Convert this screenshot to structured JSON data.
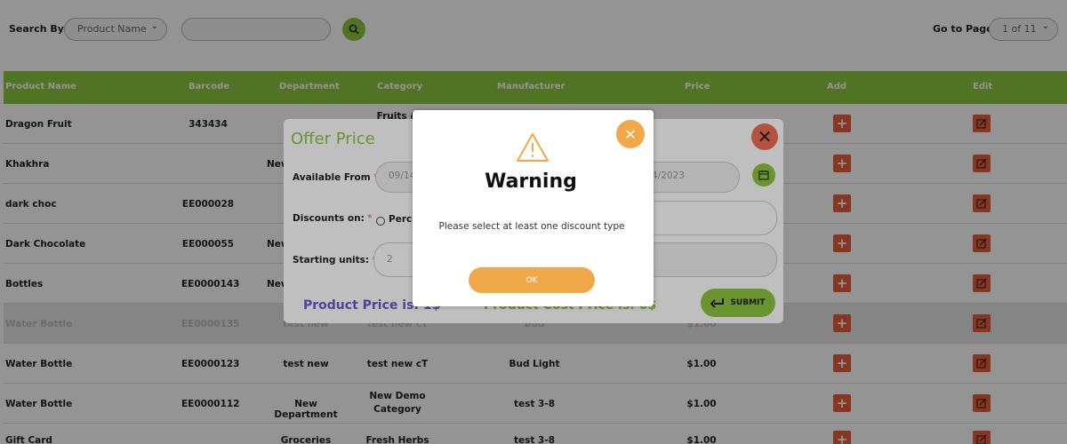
{
  "toolbar": {
    "search_by_label": "Search By:",
    "search_by_value": "Product Name",
    "search_value": "",
    "go_to_page_label": "Go to Page",
    "page_value": "1 of 11"
  },
  "table": {
    "headers": [
      "Product Name",
      "Barcode",
      "Department",
      "Category",
      "Manufacturer",
      "Price",
      "Add",
      "Edit"
    ],
    "rows": [
      {
        "name": "Dragon Fruit",
        "barcode": "343434",
        "department": "",
        "category": "Fruits &",
        "manufacturer": "",
        "price": ""
      },
      {
        "name": "Khakhra",
        "barcode": "",
        "department": "New",
        "category": "",
        "manufacturer": "",
        "price": ""
      },
      {
        "name": "dark choc",
        "barcode": "EE000028",
        "department": "",
        "category": "",
        "manufacturer": "",
        "price": ""
      },
      {
        "name": "Dark Chocolate",
        "barcode": "EE000055",
        "department": "New",
        "category": "",
        "manufacturer": "",
        "price": ""
      },
      {
        "name": "Bottles",
        "barcode": "EE0000143",
        "department": "New",
        "category": "",
        "manufacturer": "",
        "price": ""
      },
      {
        "name": "Water Bottle",
        "barcode": "EE0000135",
        "department": "test new",
        "category": "test new cT",
        "manufacturer": "Bud",
        "price": "$1.00"
      },
      {
        "name": "Water Bottle",
        "barcode": "EE0000123",
        "department": "test new",
        "category": "test new cT",
        "manufacturer": "Bud Light",
        "price": "$1.00"
      },
      {
        "name": "Water Bottle",
        "barcode": "EE0000112",
        "department": "New Department",
        "category_line1": "New Demo",
        "category_line2": "Category",
        "manufacturer": "test 3-8",
        "price": "$1.00"
      },
      {
        "name": "Gift Card",
        "barcode": "",
        "department": "Groceries",
        "category": "Fresh Herbs",
        "manufacturer": "test 3-8",
        "price": "$1.00"
      }
    ]
  },
  "offer_modal": {
    "title": "Offer Price",
    "available_from_label": "Available From",
    "available_from_value": "09/14",
    "available_to_value": "4/2023",
    "discounts_label": "Discounts on:",
    "discount_option": "Perce",
    "starting_units_label": "Starting units:",
    "starting_units_value": "2",
    "product_price": "Product Price is: 1$",
    "product_cost": "Product Cost Price is: 0$",
    "submit_label": "SUBMIT"
  },
  "warning_modal": {
    "title": "Warning",
    "message": "Please select at least one discount type",
    "ok_label": "OK"
  },
  "colors": {
    "accent": "#8cc63f",
    "danger": "#e85d3a",
    "warning": "#f0a848",
    "price_text": "#6a5acd"
  }
}
